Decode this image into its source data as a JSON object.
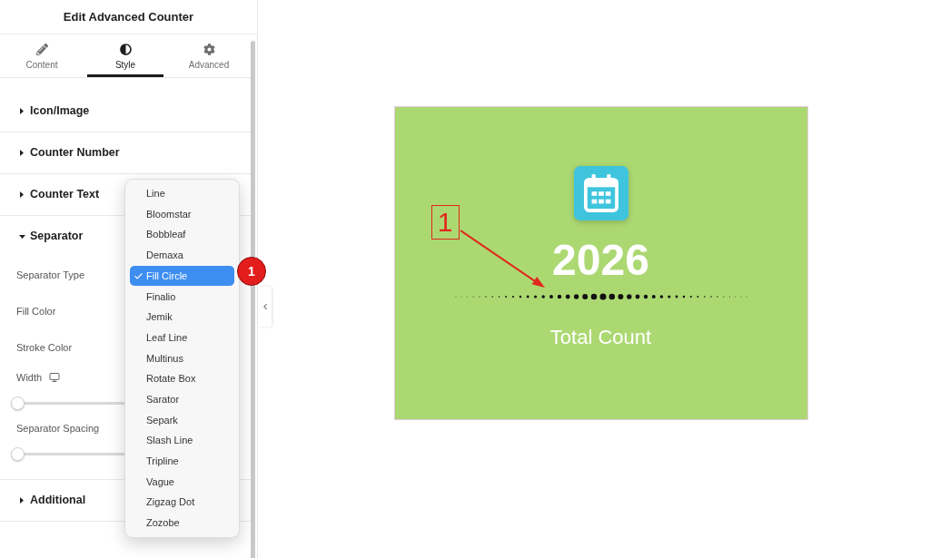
{
  "panel": {
    "title": "Edit Advanced Counter",
    "tabs": [
      {
        "label": "Content",
        "selected": false
      },
      {
        "label": "Style",
        "selected": true
      },
      {
        "label": "Advanced",
        "selected": false
      }
    ],
    "sections": [
      {
        "title": "Icon/Image",
        "expanded": false
      },
      {
        "title": "Counter Number",
        "expanded": false
      },
      {
        "title": "Counter Text",
        "expanded": false
      },
      {
        "title": "Separator",
        "expanded": true,
        "controls": [
          {
            "kind": "field",
            "label": "Separator Type",
            "open_menu": [
              {
                "label": "Line",
                "selected": false
              },
              {
                "label": "Bloomstar",
                "selected": false
              },
              {
                "label": "Bobbleaf",
                "selected": false
              },
              {
                "label": "Demaxa",
                "selected": false
              },
              {
                "label": "Fill Circle",
                "selected": true
              },
              {
                "label": "Finalio",
                "selected": false
              },
              {
                "label": "Jemik",
                "selected": false
              },
              {
                "label": "Leaf Line",
                "selected": false
              },
              {
                "label": "Multinus",
                "selected": false
              },
              {
                "label": "Rotate Box",
                "selected": false
              },
              {
                "label": "Sarator",
                "selected": false
              },
              {
                "label": "Separk",
                "selected": false
              },
              {
                "label": "Slash Line",
                "selected": false
              },
              {
                "label": "Tripline",
                "selected": false
              },
              {
                "label": "Vague",
                "selected": false
              },
              {
                "label": "Zigzag Dot",
                "selected": false
              },
              {
                "label": "Zozobe",
                "selected": false
              }
            ]
          },
          {
            "kind": "field",
            "label": "Fill Color"
          },
          {
            "kind": "field",
            "label": "Stroke Color"
          },
          {
            "kind": "slider",
            "label": "Width",
            "responsive": true,
            "level": 0
          },
          {
            "kind": "slider",
            "label": "Separator Spacing",
            "level": 0
          }
        ]
      },
      {
        "title": "Additional",
        "expanded": false
      }
    ]
  },
  "step_badge": {
    "label": "1"
  },
  "preview": {
    "number": "2026",
    "label": "Total Count",
    "callout": {
      "label": "1"
    }
  }
}
